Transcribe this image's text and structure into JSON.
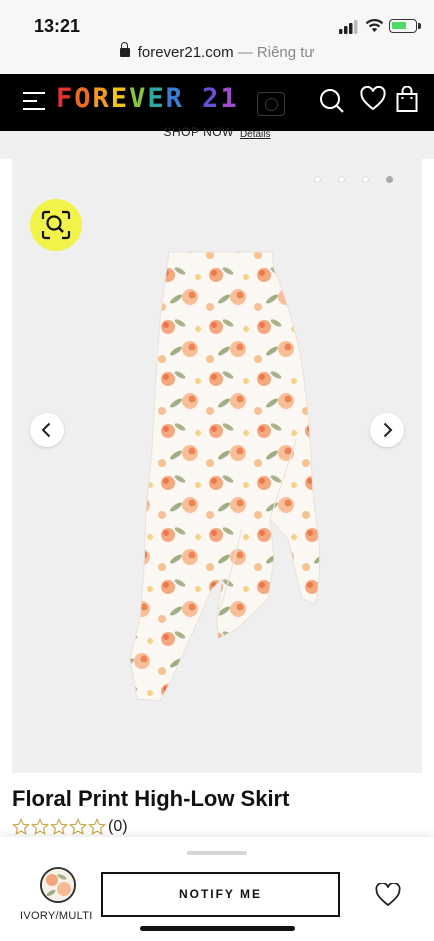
{
  "status": {
    "time": "13:21"
  },
  "browser": {
    "domain": "forever21.com",
    "suffix": " — Riêng tư"
  },
  "header": {
    "logo_letters": [
      {
        "ch": "F",
        "color": "#e8312c"
      },
      {
        "ch": "O",
        "color": "#f06a24"
      },
      {
        "ch": "R",
        "color": "#f49a1f"
      },
      {
        "ch": "E",
        "color": "#f4c41e"
      },
      {
        "ch": "V",
        "color": "#86c440"
      },
      {
        "ch": "E",
        "color": "#2fa8a0"
      },
      {
        "ch": "R",
        "color": "#3c7cd1"
      },
      {
        "ch": " ",
        "color": "#ffffff"
      },
      {
        "ch": "2",
        "color": "#6b4fd6"
      },
      {
        "ch": "1",
        "color": "#a14ccf"
      }
    ]
  },
  "promo": {
    "text": "SHOP NOW",
    "link": "Details"
  },
  "gallery": {
    "dot_count": 4,
    "active_dot": 3
  },
  "product": {
    "title": "Floral Print High-Low Skirt",
    "rating_stars": 0,
    "rating_max": 5,
    "review_count": "(0)"
  },
  "bottom": {
    "swatch_label": "IVORY/MULTI",
    "notify_label": "NOTIFY ME"
  }
}
